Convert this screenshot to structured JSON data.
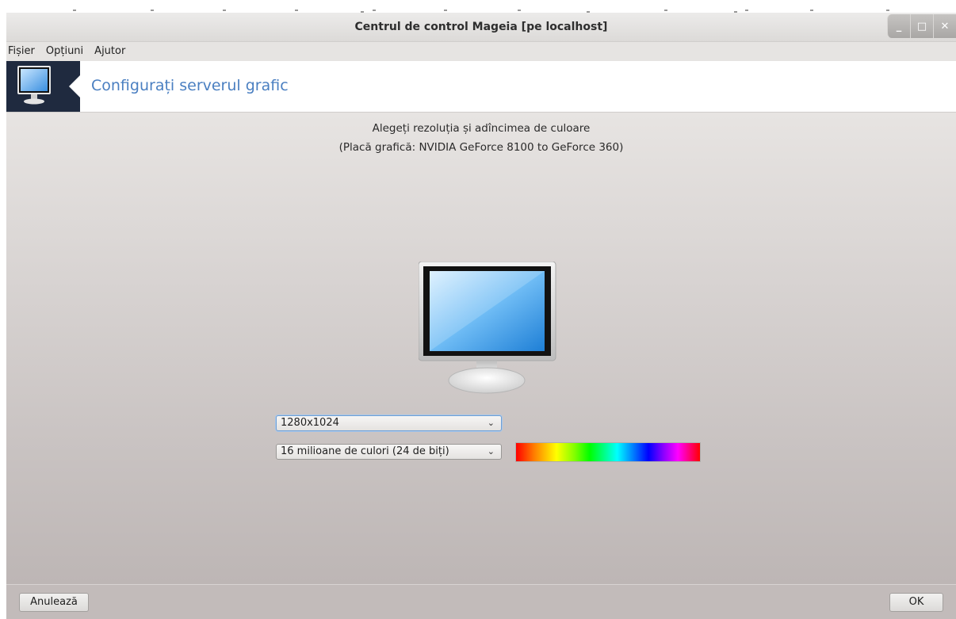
{
  "window": {
    "title": "Centrul de control Mageia  [pe localhost]",
    "controls": {
      "minimize": "_",
      "maximize": "□",
      "close": "✕"
    }
  },
  "menubar": {
    "items": [
      "Fișier",
      "Opțiuni",
      "Ajutor"
    ]
  },
  "banner": {
    "title": "Configurați serverul grafic",
    "icon": "monitor-icon"
  },
  "content": {
    "heading": "Alegeți rezoluția și adîncimea de culoare",
    "subheading": "(Placă grafică: NVIDIA GeForce 8100 to GeForce 360)",
    "monitor_icon": "monitor-icon",
    "resolution": {
      "selected": "1280x1024"
    },
    "color_depth": {
      "selected": "16 milioane de culori (24 de biți)"
    },
    "spectrum_icon": "color-spectrum-preview"
  },
  "footer": {
    "cancel_label": "Anulează",
    "ok_label": "OK"
  },
  "colors": {
    "banner_title": "#4a7fc1",
    "banner_icon_bg": "#1f2a3f",
    "focus": "#6f9fd4"
  }
}
